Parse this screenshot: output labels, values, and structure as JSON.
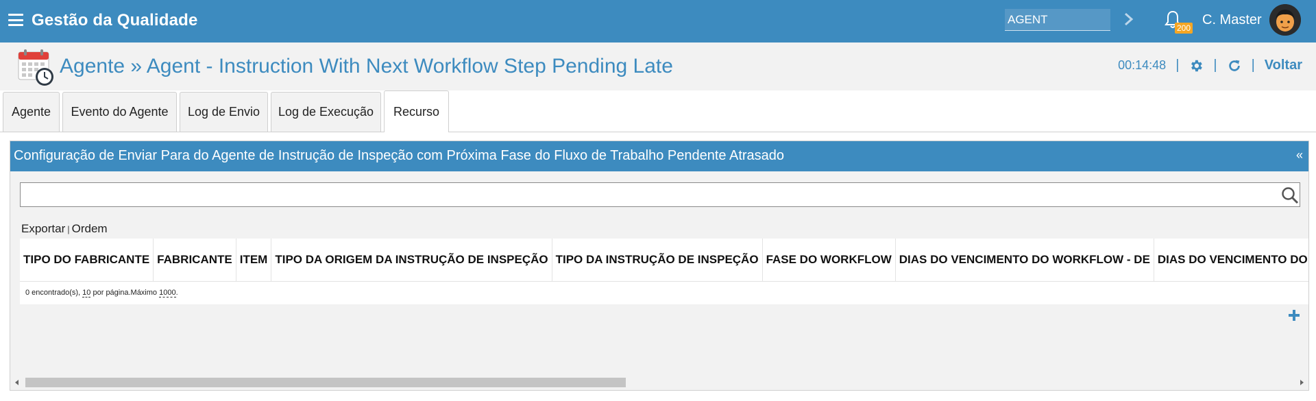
{
  "topbar": {
    "app_title": "Gestão da Qualidade",
    "search_value": "AGENT",
    "notification_count": "200",
    "user_name": "C. Master",
    "menu_icon": "hamburger-icon",
    "bell_icon": "bell-icon",
    "go_icon": "chevron-right-icon"
  },
  "header": {
    "title": "Agente » Agent - Instruction With Next Workflow Step Pending Late",
    "timer": "00:14:48",
    "sep1": "|",
    "sep2": "|",
    "sep3": "|",
    "back_label": "Voltar",
    "icons": [
      "calendar-clock-icon",
      "gear-icon",
      "refresh-icon"
    ]
  },
  "tabs": [
    {
      "label": "Agente"
    },
    {
      "label": "Evento do Agente"
    },
    {
      "label": "Log de Envio"
    },
    {
      "label": "Log de Execução"
    },
    {
      "label": "Recurso",
      "active": true
    }
  ],
  "panel": {
    "title": "Configuração de Enviar Para do Agente de Instrução de Inspeção com Próxima Fase do Fluxo de Trabalho Pendente Atrasado",
    "collapse_label": "«",
    "filter_value": "",
    "export_label": "Exportar",
    "actions_divider": "|",
    "order_label": "Ordem",
    "columns": [
      "TIPO DO FABRICANTE",
      "FABRICANTE",
      "ITEM",
      "TIPO DA ORIGEM DA INSTRUÇÃO DE INSPEÇÃO",
      "TIPO DA INSTRUÇÃO DE INSPEÇÃO",
      "FASE DO WORKFLOW",
      "DIAS DO VENCIMENTO DO WORKFLOW - DE",
      "DIAS DO VENCIMENTO DO WORKFLOW"
    ],
    "footer": {
      "found": "0 encontrado(s),",
      "per_page_value": "10",
      "per_page_text": "por página.Máximo",
      "max_value": "1000",
      "end": "."
    },
    "scroll_fraction": 0.47
  },
  "colors": {
    "brand": "#3d8bbf",
    "badge": "#f5a623",
    "panel_bg": "#f2f2f2"
  }
}
